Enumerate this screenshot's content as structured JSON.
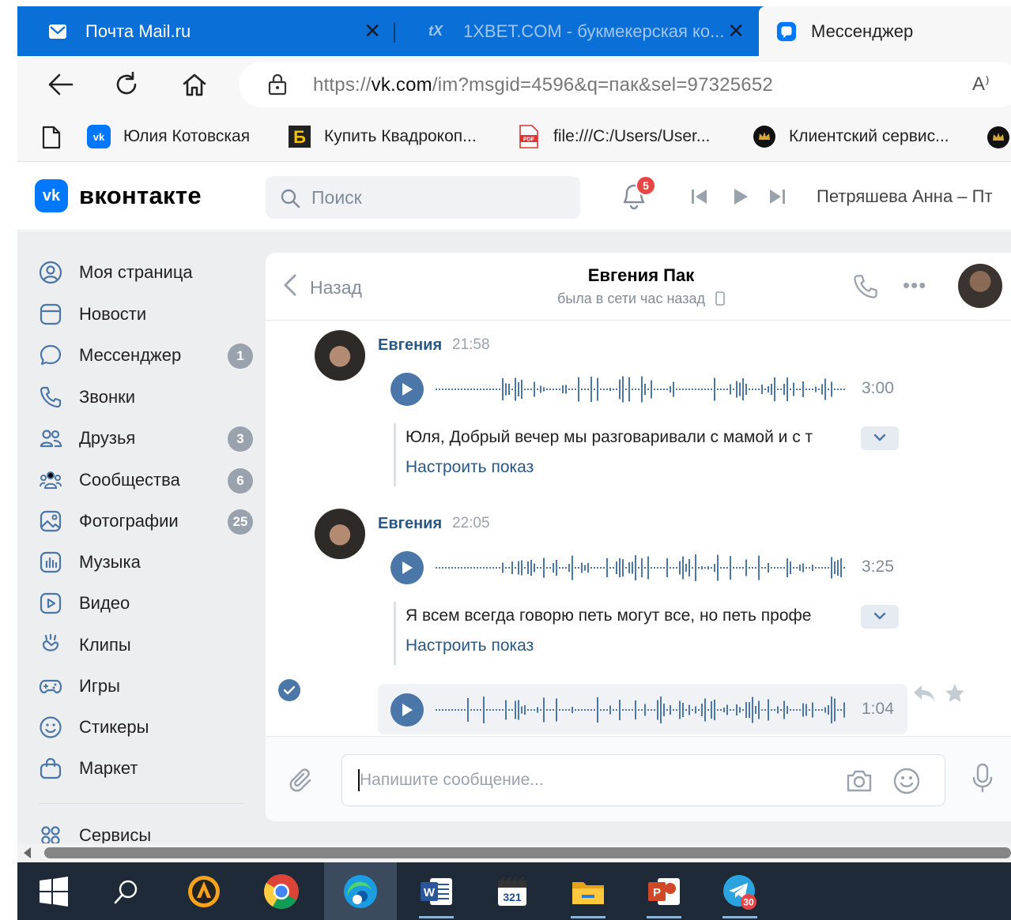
{
  "browser": {
    "tabs": [
      {
        "title": "Почта Mail.ru",
        "icon": "mail-icon"
      },
      {
        "title": "1XBET.COM - букмекерская ко...",
        "icon": "xbet-icon"
      },
      {
        "title": "Мессенджер",
        "icon": "vk-messenger-icon"
      }
    ],
    "url_prefix": "https://",
    "url_domain": "vk.com",
    "url_rest": "/im?msgid=4596&q=пак&sel=97325652",
    "read_aloud": "A⁾",
    "bookmarks": [
      {
        "label": "Юлия Котовская",
        "icon": "vk-icon"
      },
      {
        "label": "Купить Квадрокоп...",
        "icon": "b-logo-icon"
      },
      {
        "label": "file:///C:/Users/User...",
        "icon": "pdf-icon"
      },
      {
        "label": "Клиентский сервис...",
        "icon": "crown-icon"
      }
    ]
  },
  "vk": {
    "logo_text": "вконтакте",
    "search_placeholder": "Поиск",
    "notifications_count": "5",
    "now_playing": "Петряшева Анна – Пт",
    "sidebar": [
      {
        "label": "Моя страница",
        "icon": "user-circle-icon",
        "count": ""
      },
      {
        "label": "Новости",
        "icon": "news-icon",
        "count": ""
      },
      {
        "label": "Мессенджер",
        "icon": "message-icon",
        "count": "1"
      },
      {
        "label": "Звонки",
        "icon": "phone-icon",
        "count": ""
      },
      {
        "label": "Друзья",
        "icon": "friends-icon",
        "count": "3"
      },
      {
        "label": "Сообщества",
        "icon": "communities-icon",
        "count": "6"
      },
      {
        "label": "Фотографии",
        "icon": "photo-icon",
        "count": "25"
      },
      {
        "label": "Музыка",
        "icon": "music-icon",
        "count": ""
      },
      {
        "label": "Видео",
        "icon": "video-icon",
        "count": ""
      },
      {
        "label": "Клипы",
        "icon": "clips-icon",
        "count": ""
      },
      {
        "label": "Игры",
        "icon": "gamepad-icon",
        "count": ""
      },
      {
        "label": "Стикеры",
        "icon": "smile-icon",
        "count": ""
      },
      {
        "label": "Маркет",
        "icon": "bag-icon",
        "count": ""
      },
      {
        "label": "Сервисы",
        "icon": "services-icon",
        "count": ""
      }
    ],
    "chat": {
      "back_label": "Назад",
      "peer_name": "Евгения Пак",
      "peer_status": "была в сети час назад",
      "messages": [
        {
          "author": "Евгения",
          "time": "21:58",
          "duration": "3:00",
          "transcript": "Юля, Добрый вечер мы разговаривали с мамой и с т",
          "transcript_link": "Настроить показ"
        },
        {
          "author": "Евгения",
          "time": "22:05",
          "duration": "3:25",
          "transcript": "Я всем всегда говорю петь могут все, но петь профе",
          "transcript_link": "Настроить показ"
        }
      ],
      "selected_audio_duration": "1:04",
      "composer_placeholder": "Напишите сообщение..."
    }
  },
  "taskbar": [
    "windows-start-icon",
    "search-icon",
    "avast-icon",
    "chrome-icon",
    "edge-icon",
    "word-icon",
    "calendar-app-icon",
    "file-explorer-icon",
    "powerpoint-icon",
    "telegram-icon"
  ],
  "taskbar_telegram_badge": "30",
  "colors": {
    "vk_blue": "#0077ff",
    "vk_link": "#2a5885",
    "tab_blue": "#0a6fd6",
    "badge_red": "#e64646"
  }
}
